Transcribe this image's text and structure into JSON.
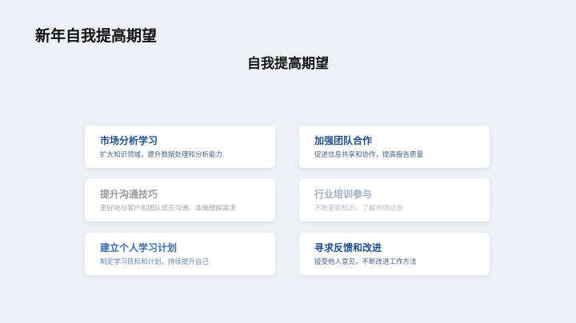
{
  "slide": {
    "title": "新年自我提高期望",
    "subtitle": "自我提高期望"
  },
  "cards": [
    {
      "title": "市场分析学习",
      "desc": "扩大知识领域，提升数据处理和分析能力"
    },
    {
      "title": "加强团队合作",
      "desc": "促进信息共享和协作，提高报告质量"
    },
    {
      "title": "提升沟通技巧",
      "desc": "更好地与客户和团队成员沟通，准确理解需求"
    },
    {
      "title": "行业培训参与",
      "desc": "不断更新知识，了解市场动态"
    },
    {
      "title": "建立个人学习计划",
      "desc": "制定学习目标和计划，持续提升自己"
    },
    {
      "title": "寻求反馈和改进",
      "desc": "接受他人意见，不断改进工作方法"
    }
  ]
}
